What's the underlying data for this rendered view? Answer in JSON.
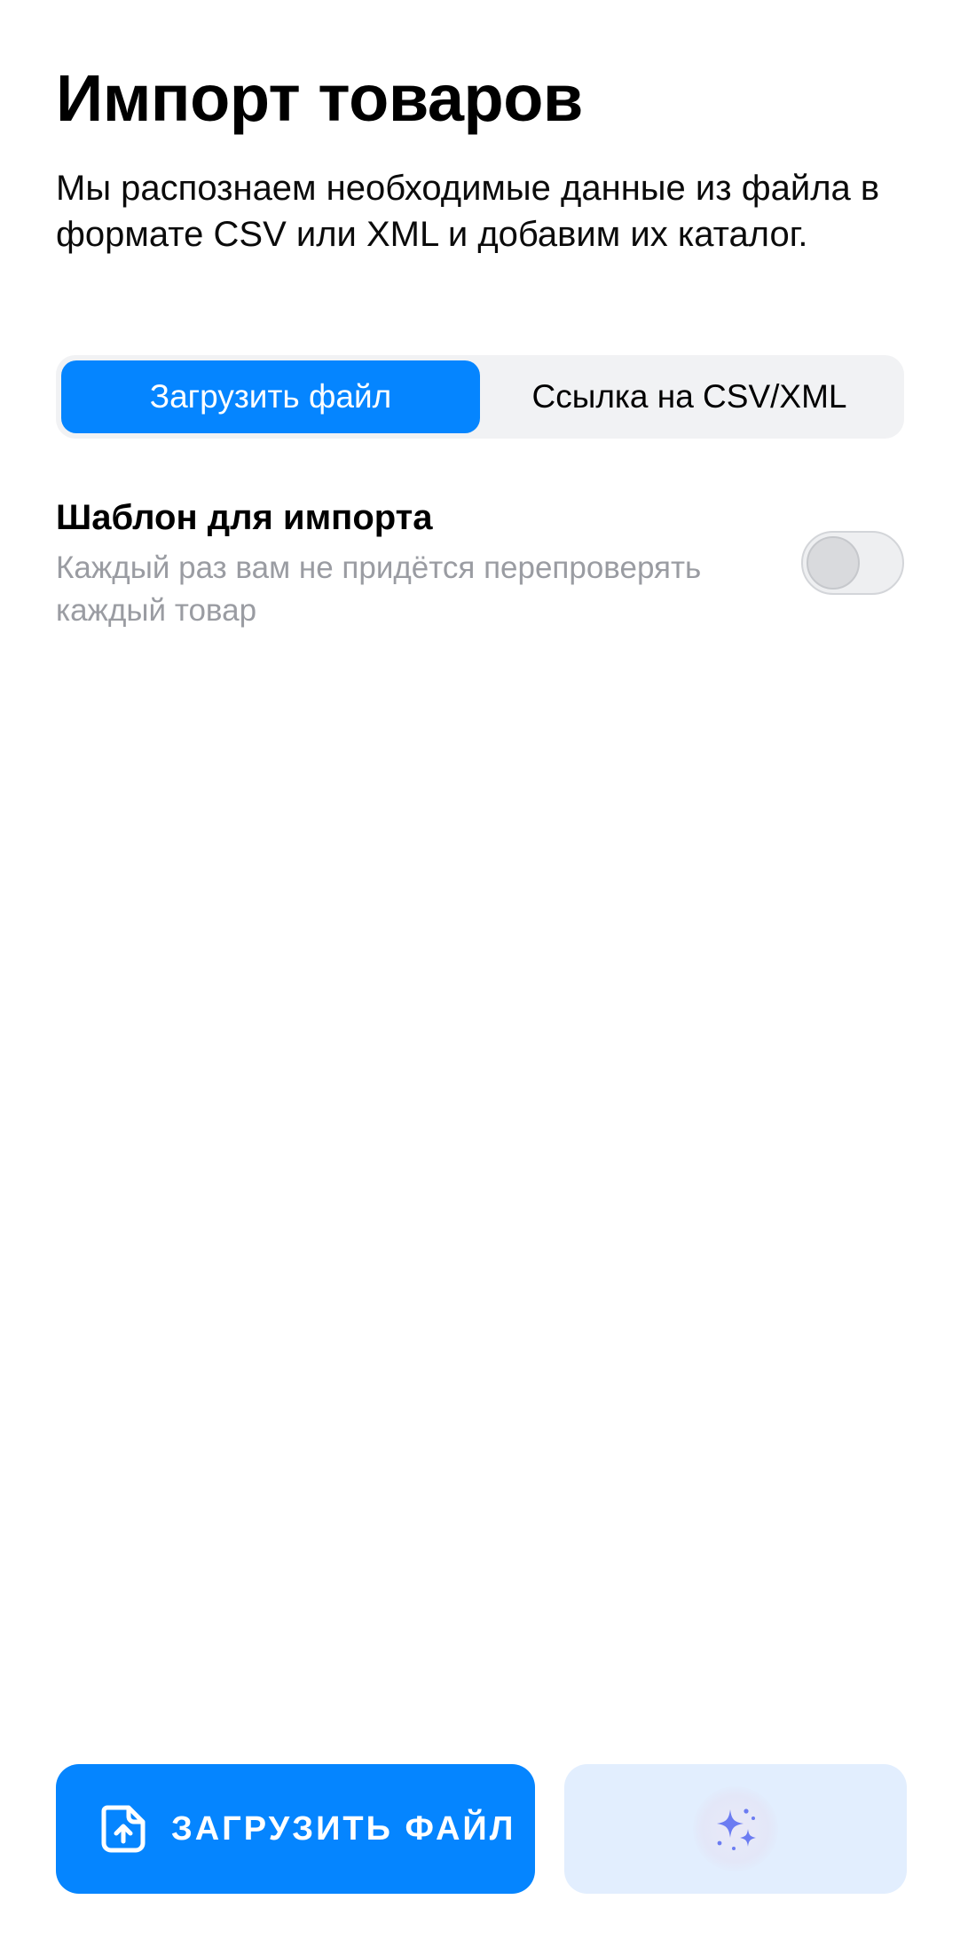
{
  "header": {
    "title": "Импорт товаров",
    "subtitle": "Мы распознаем необходимые данные из файла в формате CSV или XML и добавим их каталог."
  },
  "source_tabs": {
    "selected": "Загрузить файл",
    "items": [
      {
        "label": "Загрузить файл",
        "active": true
      },
      {
        "label": "Ссылка на CSV/XML",
        "active": false
      }
    ]
  },
  "template_option": {
    "title": "Шаблон для импорта",
    "description": "Каждый раз вам не придётся перепроверять каждый товар",
    "enabled": false
  },
  "actions": {
    "upload_label": "ЗАГРУЗИТЬ ФАЙЛ",
    "upload_icon": "file-upload-icon",
    "ai_icon": "sparkles-icon"
  },
  "colors": {
    "accent": "#0585ff",
    "secondary_button_bg": "#e2eefe",
    "sparkle": "#6b7cf2",
    "muted_text": "#9a9ca2"
  }
}
